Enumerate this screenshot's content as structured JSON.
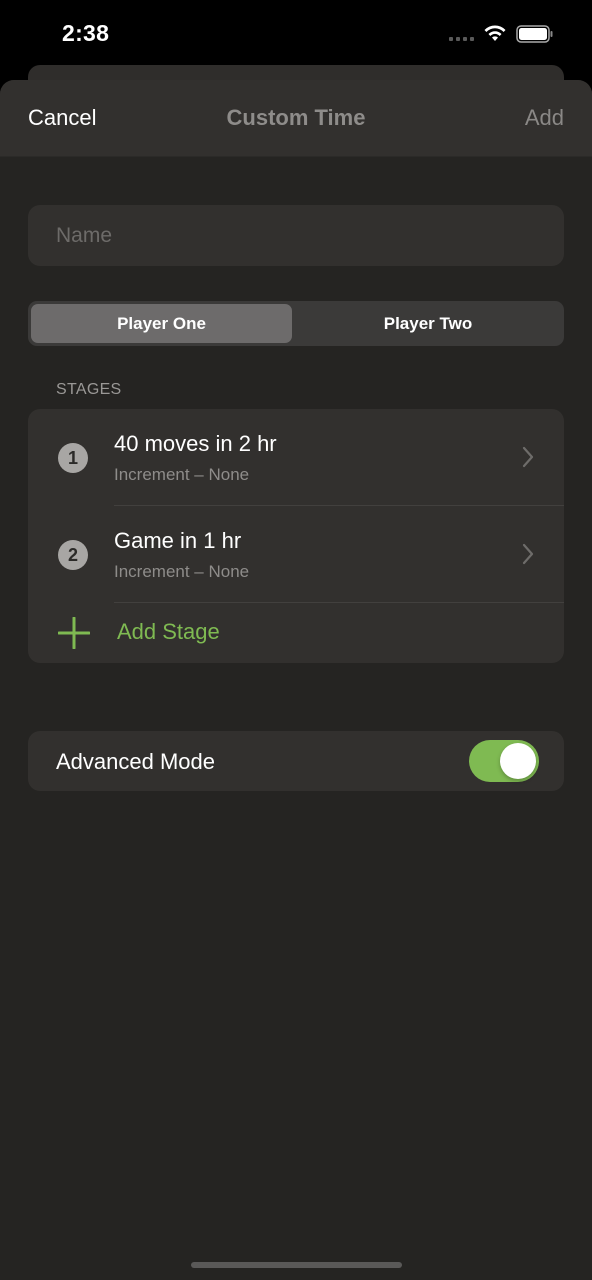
{
  "status_bar": {
    "time": "2:38",
    "icons": [
      "signal-dots-icon",
      "wifi-icon",
      "battery-icon"
    ]
  },
  "nav": {
    "cancel_label": "Cancel",
    "title": "Custom Time",
    "add_label": "Add"
  },
  "name_field": {
    "value": "",
    "placeholder": "Name"
  },
  "player_segments": {
    "options": [
      "Player One",
      "Player Two"
    ],
    "selected": "Player One"
  },
  "stages": {
    "header": "STAGES",
    "items": [
      {
        "number": "1",
        "title": "40 moves in 2 hr",
        "subtitle": "Increment – None"
      },
      {
        "number": "2",
        "title": "Game in 1 hr",
        "subtitle": "Increment – None"
      }
    ],
    "add_label": "Add Stage"
  },
  "advanced_mode": {
    "label": "Advanced Mode",
    "enabled": true
  },
  "colors": {
    "accent": "#7fba52",
    "background": "#252422",
    "card": "#32302e"
  }
}
